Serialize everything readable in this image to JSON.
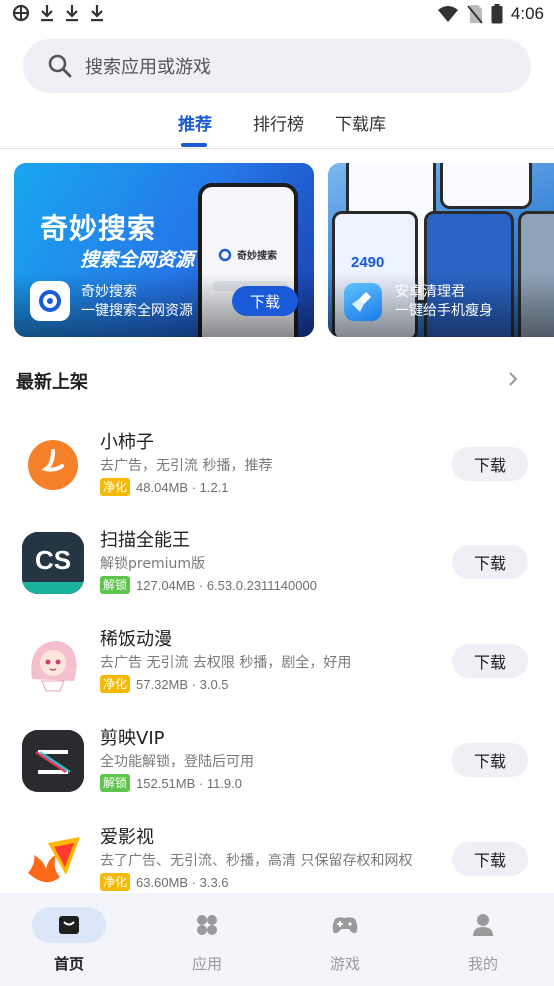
{
  "status_bar": {
    "time": "4:06",
    "left_icons": [
      "sync-icon",
      "download-icon",
      "download-icon",
      "download-icon"
    ],
    "right_icons": [
      "wifi-icon",
      "no-sim-icon",
      "battery-icon"
    ]
  },
  "search": {
    "placeholder": "搜索应用或游戏"
  },
  "tabs": [
    {
      "label": "推荐",
      "active": true
    },
    {
      "label": "排行榜",
      "active": false
    },
    {
      "label": "下载库",
      "active": false
    }
  ],
  "banners": [
    {
      "headline": "奇妙搜索",
      "subheadline": "搜索全网资源",
      "app_name": "奇妙搜索",
      "app_desc": "一键搜索全网资源",
      "phone_label": "奇妙搜索",
      "download_label": "下载"
    },
    {
      "app_name": "安卓清理君",
      "app_desc": "一键给手机瘦身",
      "screen_number": "2490"
    }
  ],
  "section": {
    "title": "最新上架"
  },
  "apps": [
    {
      "name": "小柿子",
      "desc": "去广告，无引流 秒播，推荐",
      "badge": "净化",
      "meta": "48.04MB · 1.2.1",
      "download_label": "下载",
      "icon": "persimmon-icon"
    },
    {
      "name": "扫描全能王",
      "desc": "解锁premium版",
      "badge": "解锁",
      "meta": "127.04MB · 6.53.0.2311140000",
      "download_label": "下载",
      "icon": "camscanner-icon"
    },
    {
      "name": "稀饭动漫",
      "desc": "去广告 无引流 去权限 秒播，剧全，好用",
      "badge": "净化",
      "meta": "57.32MB · 3.0.5",
      "download_label": "下载",
      "icon": "anime-girl-icon"
    },
    {
      "name": "剪映VIP",
      "desc": "全功能解锁，登陆后可用",
      "badge": "解锁",
      "meta": "152.51MB · 11.9.0",
      "download_label": "下载",
      "icon": "capcut-icon"
    },
    {
      "name": "爱影视",
      "desc": "去了广告、无引流、秒播，高清 只保留存权和网权",
      "badge": "净化",
      "meta": "63.60MB · 3.3.6",
      "download_label": "下载",
      "icon": "flame-play-icon"
    }
  ],
  "colors": {
    "accent": "#1a5ad8",
    "badge_jinghua": "#f5b908",
    "badge_jiesuo": "#5ec44d"
  },
  "bottom_nav": [
    {
      "label": "首页",
      "icon": "home-icon",
      "active": true
    },
    {
      "label": "应用",
      "icon": "apps-icon",
      "active": false
    },
    {
      "label": "游戏",
      "icon": "gamepad-icon",
      "active": false
    },
    {
      "label": "我的",
      "icon": "person-icon",
      "active": false
    }
  ]
}
